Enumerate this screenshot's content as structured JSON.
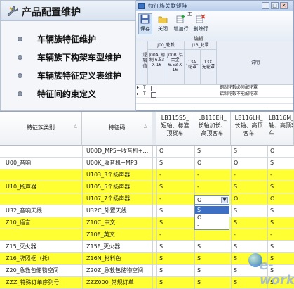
{
  "back_window": {
    "title": "特征族关联矩阵",
    "controls": [
      "—",
      "□",
      "✕"
    ],
    "ribbon": {
      "buttons": [
        {
          "label": "保存",
          "icon": "save-icon"
        },
        {
          "label": "关闭",
          "icon": "folder-close-icon"
        },
        {
          "label": "增加行",
          "icon": "add-row-icon"
        },
        {
          "label": "删除行",
          "icon": "delete-row-icon"
        }
      ],
      "top_marker": "工",
      "group_label": "编辑"
    },
    "matrix_header": {
      "group1": "J00_轮毂",
      "group2": "J13_轮罩",
      "side_label": "逻辑值",
      "col1": "J00A_钢制 6.53 X 16",
      "col2": "J00B_铝合金 6.53 X 16",
      "col3": "J13A_轮罩",
      "col4": "J13X_无轮罩",
      "desc": "说明"
    },
    "matrix_rows": [
      {
        "logic": "T",
        "desc": "钢制轮毂必须配轮罩"
      },
      {
        "logic": "T",
        "desc": "铝制轮毂不能配轮罩"
      },
      {
        "logic": "",
        "desc": ""
      },
      {
        "logic": "",
        "desc": ""
      }
    ],
    "bottom_marker": "s"
  },
  "menu": {
    "title": "产品配置维护",
    "items": [
      {
        "label": "车辆族特征维护"
      },
      {
        "label": "车辆族下构架车型维护"
      },
      {
        "label": "车辆族特征定义表维护"
      },
      {
        "label": "特征间约束定义"
      }
    ]
  },
  "grid": {
    "columns": {
      "family": "特征族类别",
      "code": "特征码",
      "sort_mark": "△",
      "lb115": "LB115S5_短轴、标准顶货车",
      "lb116eh": "LB116EH_长轴加长、高顶客车",
      "lb116lh": "LB116LH_长轴、高顶客车",
      "lb116m": "LB116M_中轴、高顶客车"
    },
    "rows": [
      {
        "family": "",
        "code": "U00D_MP5+收音机+…",
        "v1": "O",
        "v2": "S",
        "v3": "S",
        "v4": "O",
        "hl": false
      },
      {
        "family": "U00_音响",
        "code": "U00K_收音机+MP3",
        "v1": "S",
        "v2": "O",
        "v3": "O",
        "v4": "S",
        "hl": false
      },
      {
        "family": "",
        "code": "U103_3个扬声器",
        "v1": "-",
        "v2": "-",
        "v3": "-",
        "v4": "-",
        "hl": true
      },
      {
        "family": "U10_扬声器",
        "code": "U105_5个扬声器",
        "v1": "S",
        "v2": "-",
        "v3": "S",
        "v4": "S",
        "hl": true
      },
      {
        "family": "",
        "code": "U107_7个扬声器",
        "v1": "-",
        "v2": "",
        "v3": "O",
        "v4": "O",
        "hl": true
      },
      {
        "family": "U32_音响天线",
        "code": "U32C_外置天线",
        "v1": "S",
        "v2": "",
        "v3": "S",
        "v4": "S",
        "hl": false
      },
      {
        "family": "Z10_语言",
        "code": "Z10C_中文",
        "v1": "S",
        "v2": "",
        "v3": "S",
        "v4": "S",
        "hl": true
      },
      {
        "family": "",
        "code": "Z10E_英文",
        "v1": "-",
        "v2": "",
        "v3": "-",
        "v4": "-",
        "hl": true
      },
      {
        "family": "Z15_灭火器",
        "code": "Z15F_灭火器",
        "v1": "S",
        "v2": "S",
        "v3": "S",
        "v4": "S",
        "hl": false
      },
      {
        "family": "Z16_牌照框（托）",
        "code": "Z16N_材料色",
        "v1": "S",
        "v2": "S",
        "v3": "S",
        "v4": "S",
        "hl": true
      },
      {
        "family": "Z20_急救包储物空间",
        "code": "Z20Z_急救包储物空间",
        "v1": "S",
        "v2": "S",
        "v3": "S",
        "v4": "S",
        "hl": false
      },
      {
        "family": "ZZZ_特殊订单序列号",
        "code": "ZZZ000_常规订单",
        "v1": "S",
        "v2": "S",
        "v3": "S",
        "v4": "S",
        "hl": true
      }
    ],
    "dropdown": {
      "value": "O",
      "arrow": "▼",
      "options": [
        "S",
        "O",
        "-"
      ]
    }
  },
  "watermark": "e-works",
  "colors": {
    "highlight": "#ffff33",
    "accent": "#3b72c4",
    "grid_line": "#d7dbe2"
  }
}
